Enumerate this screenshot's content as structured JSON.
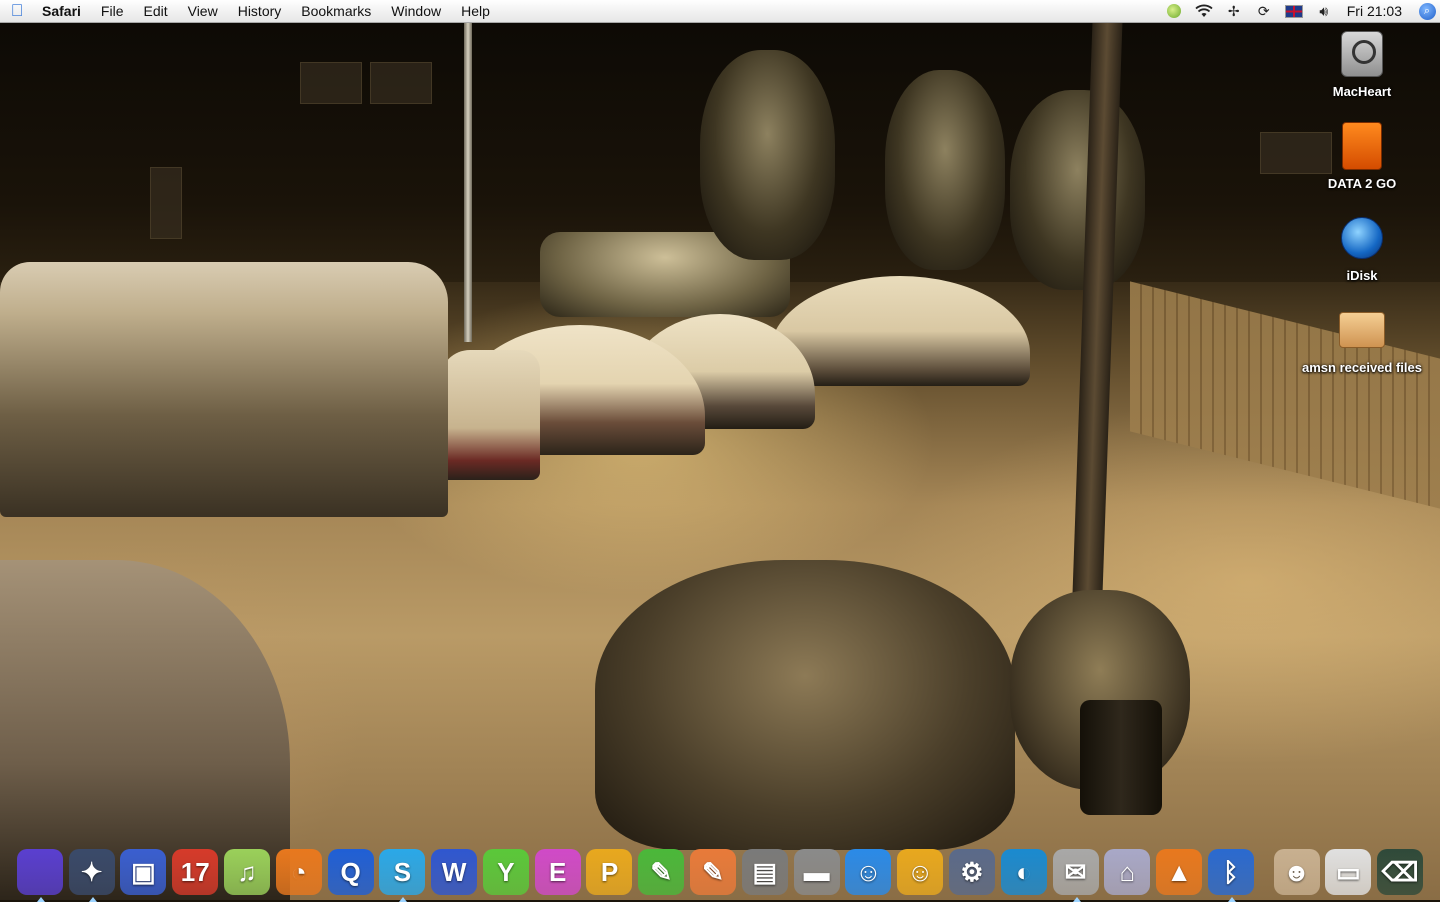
{
  "menubar": {
    "app_name": "Safari",
    "menus": [
      "File",
      "Edit",
      "View",
      "History",
      "Bookmarks",
      "Window",
      "Help"
    ],
    "status_icons": [
      "msn-icon",
      "wifi-icon",
      "bluetooth-status-icon",
      "sync-icon",
      "input-flag-icon",
      "volume-icon"
    ],
    "clock": "Fri 21:03"
  },
  "desktop": {
    "icons": [
      {
        "label": "MacHeart",
        "icon": "hard-drive-icon"
      },
      {
        "label": "DATA 2 GO",
        "icon": "usb-drive-icon"
      },
      {
        "label": "iDisk",
        "icon": "idisk-globe-icon"
      },
      {
        "label": "amsn received files",
        "icon": "folder-icon"
      }
    ]
  },
  "dock": {
    "items": [
      {
        "name": "finder",
        "glyph": "",
        "color": "#5a3fd0",
        "running": true
      },
      {
        "name": "safari",
        "glyph": "✦",
        "color": "#3a4a6a",
        "running": true
      },
      {
        "name": "preview",
        "glyph": "▣",
        "color": "#3a5fd0",
        "running": false
      },
      {
        "name": "ical",
        "glyph": "17",
        "color": "#d63a2a",
        "running": false
      },
      {
        "name": "itunes",
        "glyph": "♫",
        "color": "#9ad05a",
        "running": false
      },
      {
        "name": "firefox",
        "glyph": "◔",
        "color": "#e8781e",
        "running": false
      },
      {
        "name": "quicktime",
        "glyph": "Q",
        "color": "#1f5fd6",
        "running": false
      },
      {
        "name": "skype",
        "glyph": "S",
        "color": "#2aa8e8",
        "running": true
      },
      {
        "name": "letter-w",
        "glyph": "W",
        "color": "#2f57d0",
        "running": false
      },
      {
        "name": "letter-y",
        "glyph": "Y",
        "color": "#5ac83a",
        "running": false
      },
      {
        "name": "letter-e",
        "glyph": "E",
        "color": "#d04ac8",
        "running": false
      },
      {
        "name": "letter-p",
        "glyph": "P",
        "color": "#e8a81e",
        "running": false
      },
      {
        "name": "green-pen",
        "glyph": "✎",
        "color": "#4ab83a",
        "running": false
      },
      {
        "name": "orange-pen",
        "glyph": "✎",
        "color": "#e87a3a",
        "running": false
      },
      {
        "name": "system-prefs",
        "glyph": "▤",
        "color": "#7a7a7a",
        "running": false
      },
      {
        "name": "printer",
        "glyph": "▬",
        "color": "#8a8a8a",
        "running": false
      },
      {
        "name": "messenger-1",
        "glyph": "☺",
        "color": "#2a8ae8",
        "running": false
      },
      {
        "name": "messenger-2",
        "glyph": "☺",
        "color": "#e8a81e",
        "running": false
      },
      {
        "name": "utility",
        "glyph": "⚙",
        "color": "#5a6a8a",
        "running": false
      },
      {
        "name": "widget",
        "glyph": "◐",
        "color": "#1a8ad0",
        "running": false
      },
      {
        "name": "mail-tool",
        "glyph": "✉",
        "color": "#a8a8a8",
        "running": true
      },
      {
        "name": "home-tool",
        "glyph": "⌂",
        "color": "#a8a8c8",
        "running": false
      },
      {
        "name": "vlc",
        "glyph": "▲",
        "color": "#e8781e",
        "running": false
      },
      {
        "name": "bluetooth",
        "glyph": "ᛒ",
        "color": "#2a6ad0",
        "running": true
      }
    ],
    "right_items": [
      {
        "name": "photo-thumbnail",
        "glyph": "☻",
        "color": "#c8b090"
      },
      {
        "name": "window-minimized",
        "glyph": "▭",
        "color": "#e0e0e0"
      },
      {
        "name": "trash",
        "glyph": "⌫",
        "color": "#2f4a3a"
      }
    ]
  }
}
